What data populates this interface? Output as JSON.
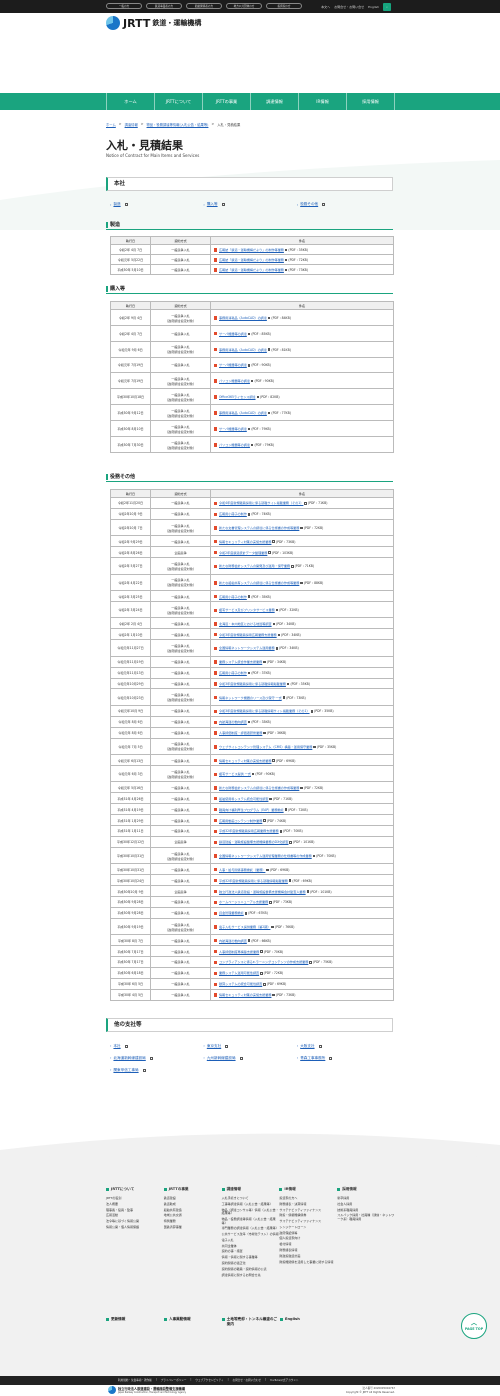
{
  "topbar": {
    "buttons": [
      "一般の方",
      "鉄道事業者の方",
      "船舶関係者の方",
      "地方公共団体の方",
      "投資家の方"
    ],
    "right": [
      "本文へ",
      "お問合せ・お問い合せ",
      "English"
    ],
    "search_icon": "search-icon"
  },
  "logo": {
    "name": "JRTT",
    "sub": "鉄道・運輸機構"
  },
  "gnav": [
    "ホーム",
    "JRTTについて",
    "JRTTの事業",
    "調達情報",
    "IR情報",
    "採用情報"
  ],
  "breadcrumb": [
    "ホーム",
    "調達情報",
    "物品・役務調達等情報(入札公告・結果等)",
    "入札・見積結果"
  ],
  "page": {
    "title": "入札・見積結果",
    "subtitle": "Notice of Contract for Main Items and Services"
  },
  "honsha": {
    "heading": "本社",
    "links": [
      "製造",
      "購入等",
      "役務その他"
    ]
  },
  "headers": {
    "date": "執行日",
    "method": "契約方式",
    "item": "件名"
  },
  "seizo": {
    "heading": "製造",
    "rows": [
      [
        "令和2年 4月 7日",
        "一般競争入札",
        "広報誌「鉄道・運輸機構だより」の制作等業務",
        "(PDF : 35KB)"
      ],
      [
        "令和元年 5月22日",
        "一般競争入札",
        "広報誌「鉄道・運輸機構だより」の制作等業務",
        "(PDF : 72KB)"
      ],
      [
        "平成30年 5月10日",
        "一般競争入札",
        "広報誌「鉄道・運輸機構だより」の制作等業務",
        "(PDF : 73KB)"
      ]
    ]
  },
  "konyu": {
    "heading": "購入等",
    "rows": [
      [
        "令和2年 9月 4日",
        "一般競争入札\n（政府調達協定対象）",
        "事務用消耗品（AutoCAD）の調達",
        "(PDF : 84KB)"
      ],
      [
        "令和2年 4月 7日",
        "一般競争入札",
        "サーバ機器等の調達",
        "(PDF : 85KB)"
      ],
      [
        "令和元年 9月 6日",
        "一般競争入札\n（政府調達協定対象）",
        "事務用消耗品（AutoCAD）の調達",
        "(PDF : 81KB)"
      ],
      [
        "令和元年 7月19日",
        "一般競争入札",
        "サーバ機器等の調達",
        "(PDF : 90KB)"
      ],
      [
        "令和元年 7月19日",
        "一般競争入札\n（政府調達協定対象）",
        "パソコン機器等の調達",
        "(PDF : 90KB)"
      ],
      [
        "平成30年10月18日",
        "一般競争入札\n（政府調達協定対象）",
        "Office365ライセンス調達",
        "(PDF : 82KB)"
      ],
      [
        "平成30年 9月12日",
        "一般競争入札\n（政府調達協定対象）",
        "事務用消耗品（AutoCAD）の調達",
        "(PDF : 77KB)"
      ],
      [
        "平成30年 8月10日",
        "一般競争入札\n（政府調達協定対象）",
        "サーバ機器等の調達",
        "(PDF : 79KB)"
      ],
      [
        "平成30年 7月30日",
        "一般競争入札\n（政府調達協定対象）",
        "パソコン機器等の調達",
        "(PDF : 79KB)"
      ]
    ]
  },
  "ekimu": {
    "heading": "役務その他",
    "rows": [
      [
        "令和2年11月20日",
        "一般競争入札",
        "令和4年度新規職員採用に係る就職サイト掲載業務（その1）",
        "(PDF : 71KB)"
      ],
      [
        "令和2年10月 9日",
        "一般競争入札",
        "広報用小冊子の制作",
        "(PDF : 74KB)"
      ],
      [
        "令和2年10月 7日",
        "一般競争入札\n（政府調達協定対象）",
        "新たな文書管理システムの調達に係る仕様書の作成等業務",
        "(PDF : 72KB)"
      ],
      [
        "令和2年 9月29日",
        "一般競争入札",
        "情報セキュリティ対策の実施支援業務",
        "(PDF : 73KB)"
      ],
      [
        "令和2年 8月26日",
        "企画競争",
        "令和2年度鉄道統計データ整理業務",
        "(PDF : 103KB)"
      ],
      [
        "令和2年 5月27日",
        "一般競争入札\n（政府調達協定対象）",
        "新たな財務会計システムの開発及び運用・保守業務",
        "(PDF : 71KB)"
      ],
      [
        "令和2年 4月22日",
        "一般競争入札\n（政府調達協定対象）",
        "新たな船舶共有システムの調達に係る仕様書の作成等業務",
        "(PDF : 88KB)"
      ],
      [
        "令和2年 3月25日",
        "一般競争入札",
        "広報用小冊子の制作",
        "(PDF : 35KB)"
      ],
      [
        "令和2年 3月24日",
        "一般競争入札\n（政府調達協定対象）",
        "複写サービス及びプリンタサービス業務",
        "(PDF : 32KB)"
      ],
      [
        "令和2年 2月 4日",
        "一般競争入札",
        "北海道・本州地区における地質等調査",
        "(PDF : 34KB)"
      ],
      [
        "令和2年 1月10日",
        "一般競争入札",
        "令和3年度新規職員採用広報業務支援業務",
        "(PDF : 34KB)"
      ],
      [
        "令和元年11月27日",
        "一般競争入札\n（政府調達協定対象）",
        "全国情報ネットワークシステム運用業務",
        "(PDF : 34KB)"
      ],
      [
        "令和元年11月19日",
        "一般競争入札",
        "業務システム統合作業支援業務",
        "(PDF : 34KB)"
      ],
      [
        "令和元年11月13日",
        "一般競争入札",
        "広報用小冊子の制作",
        "(PDF : 37KB)"
      ],
      [
        "令和元年10月29日",
        "一般競争入札",
        "令和3年度新規職員採用に係る就職情報掲載業務",
        "(PDF : 35KB)"
      ],
      [
        "令和元年10月23日",
        "一般競争入札\n（政府調達協定対象）",
        "情報ネットワーク機器のリース及び保守 一式",
        "(PDF : 73KB)"
      ],
      [
        "令和元年10月 9日",
        "一般競争入札",
        "令和3年度新規職員採用に係る就職情報サイト掲載業務（その1）",
        "(PDF : 35KB)"
      ],
      [
        "令和元年 8月 6日",
        "一般競争入札",
        "内航海運の動向調査",
        "(PDF : 33KB)"
      ],
      [
        "令和元年 8月 6日",
        "一般競争入札",
        "人事評価制度・評価者研修業務",
        "(PDF : 36KB)"
      ],
      [
        "令和元年 7月 5日",
        "一般競争入札\n（政府調達協定対象）",
        "ウェブサイトコンテンツ管理システム（CMS）構築・運用保守業務",
        "(PDF : 35KB)"
      ],
      [
        "令和元年 6月13日",
        "一般競争入札",
        "情報セキュリティ対策の実施支援業務",
        "(PDF : 69KB)"
      ],
      [
        "令和元年 6月 3日",
        "一般競争入札\n（政府調達協定対象）",
        "複写サービス提供 一式",
        "(PDF : 90KB)"
      ],
      [
        "令和元年 5月16日",
        "一般競争入札",
        "新たな財務会計システムの調達に係る仕様書の作成等業務",
        "(PDF : 72KB)"
      ],
      [
        "平成31年 4月26日",
        "一般競争入札",
        "船舶使用料システム統合可能性調査",
        "(PDF : 71KB)"
      ],
      [
        "平成31年 4月19日",
        "一般競争入札",
        "職員向け福利厚生プログラム（EAP）業務委託",
        "(PDF : 72KB)"
      ],
      [
        "平成31年 1月29日",
        "一般競争入札",
        "広報用動画コンテンツ制作業務",
        "(PDF : 74KB)"
      ],
      [
        "平成31年 1月11日",
        "一般競争入札",
        "平成32年度新規職員採用広報業務支援業務",
        "(PDF : 70KB)"
      ],
      [
        "平成30年12月12日",
        "企画競争",
        "鉄道建設・運輸施設整備支援機構業務のDX化調査",
        "(PDF : 101KB)"
      ],
      [
        "平成30年10月31日",
        "一般競争入札\n（政府調達協定対象）",
        "全国情報ネットワークシステム運用管理業務の仕様書等の作成業務",
        "(PDF : 70KB)"
      ],
      [
        "平成30年10月31日",
        "一般競争入札",
        "人事・給与関係事務委託（業務）",
        "(PDF : 69KB)"
      ],
      [
        "平成30年10月24日",
        "一般競争入札",
        "平成32年度新規職員採用に係る就職情報掲載業務",
        "(PDF : 69KB)"
      ],
      [
        "平成30年10月 9日",
        "企画競争",
        "独立行政法人鉄道建設・運輸施設整備支援機構会計監査人業務",
        "(PDF : 101KB)"
      ],
      [
        "平成30年 9月28日",
        "一般競争入札",
        "ホームページリニューアル支援業務",
        "(PDF : 73KB)"
      ],
      [
        "平成30年 9月28日",
        "一般競争入札",
        "資金管理業務委託",
        "(PDF : 67KB)"
      ],
      [
        "平成30年 9月19日",
        "一般競争入札\n（政府調達協定対象）",
        "電子入札サービス提供業務（第2期）",
        "(PDF : 76KB)"
      ],
      [
        "平成30年 8月 7日",
        "一般競争入札",
        "内航海運の動向調査",
        "(PDF : 66KB)"
      ],
      [
        "平成30年 7月17日",
        "一般競争入札",
        "人事評価制度再構築支援業務",
        "(PDF : 70KB)"
      ],
      [
        "平成30年 7月17日",
        "一般競争入札",
        "コンプライアンスに係るe-ラーニングコンテンツの作成支援業務",
        "(PDF : 75KB)"
      ],
      [
        "平成30年 6月18日",
        "一般競争入札",
        "業務システム運用可能性調査",
        "(PDF : 72KB)"
      ],
      [
        "平成30年 6月 5日",
        "一般競争入札",
        "積算システムの統合可能性調査",
        "(PDF : 69KB)"
      ],
      [
        "平成30年 4月 5日",
        "一般競争入札",
        "情報セキュリティ対策の実施支援業務",
        "(PDF : 73KB)"
      ]
    ]
  },
  "others": {
    "heading": "他の支社等",
    "links": [
      "本社",
      "東京支社",
      "大阪支社",
      "北海道新幹線建設局",
      "九州新幹線建設局",
      "青森工事事務所",
      "関東甲信工事局"
    ]
  },
  "footer": {
    "cols": [
      {
        "title": "JRTTについて",
        "items": [
          "JRTTの役割",
          "法人概要",
          "理事長・役員・監事",
          "広報活動",
          "法令等に基づく情報公開",
          "情報公開・個人情報保護"
        ]
      },
      {
        "title": "JRTTの事業",
        "items": [
          "鉄道建設",
          "鉄道助成",
          "船舶共有建造",
          "地域公共交通",
          "特例業務",
          "国鉄清算事業"
        ]
      },
      {
        "title": "調達情報",
        "items": [
          "入札手続きについて",
          "工事等調達情報（入札公告・結果等）",
          "物品（調達コンサル等）情報（入札公告・結果等）",
          "物品・役務調達等情報（入札公告・結果等）",
          "専門業務の調達情報（入札公告・結果等）",
          "公共サービス改革（市場化テスト）の情報",
          "電子入札",
          "共同企業体",
          "契約の事・措置",
          "情報・情報に関する事業等",
          "契約関係の適正化",
          "契約関係の職員・契約情報の公表",
          "調達情報に関するお問合せ先"
        ]
      },
      {
        "title": "IR情報",
        "items": [
          "投資家の方へ",
          "財務諸表・決算情報",
          "サステナビリティファイナンス",
          "財投・債権機構債券",
          "サステナビリティファイナンス",
          "シンジケートローン",
          "政府保証債等",
          "個人投資家向け",
          "格付情報",
          "財務諸表情報",
          "財政投融資計画",
          "財投機関債を活用した事業に関する情報"
        ]
      },
      {
        "title": "採用情報",
        "items": [
          "新卒採用",
          "社会人採用",
          "技術系職員採用",
          "スルバック採用・社員種（通信・ネットワーク系）職員採用"
        ]
      }
    ],
    "row2": [
      "更新情報",
      "人事異動情報",
      "土地等売却・トンネル譲渡のご案内",
      "English"
    ],
    "pagetop": "PAGE TOP",
    "bar": [
      "利用規約・免責事項・著作権",
      "プライバシーポリシー",
      "ウェブアクセシビリティ",
      "お問合せ・お問い合わせ",
      "YouTube公式アカウント"
    ],
    "org_ja": "独立行政法人鉄道建設・運輸施設整備支援機構",
    "org_en": "Japan Railway Construction, Transport and Technology Agency",
    "corp_no": "法人番号 4020005004767",
    "copyright": "Copyright © JRTT All Rights Reserved."
  },
  "colors": {
    "accent": "#1aa47f",
    "link": "#1d5fb8",
    "dark": "#1c1c1c"
  }
}
